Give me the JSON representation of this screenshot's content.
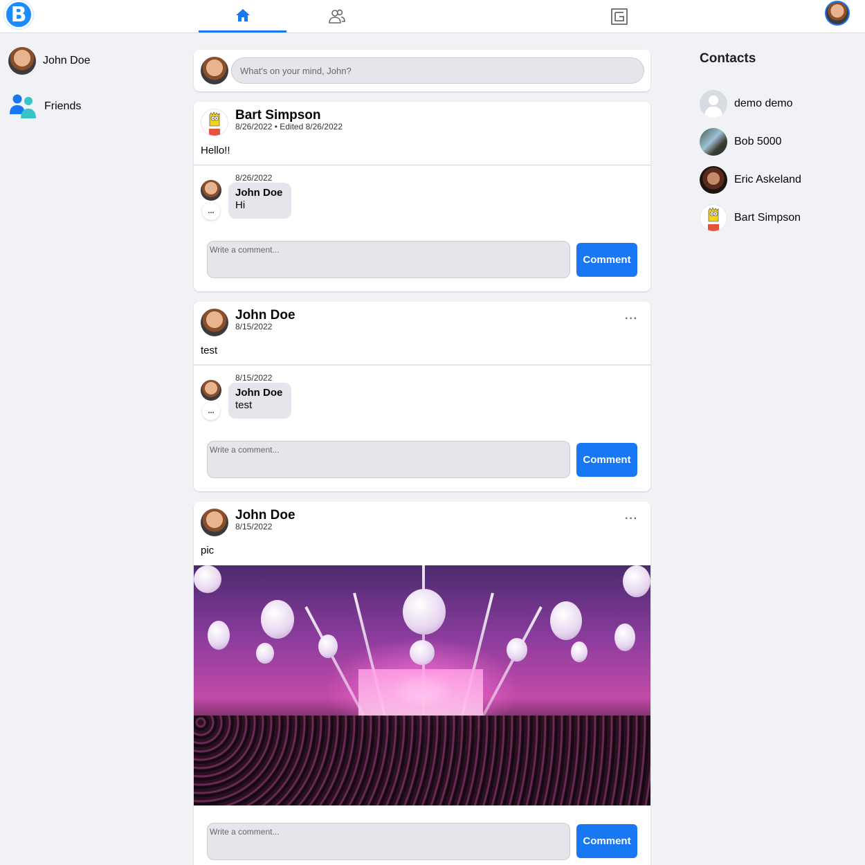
{
  "brand": {
    "logo_letter": "B"
  },
  "nav": {
    "tabs": [
      "home",
      "friends",
      "pages"
    ],
    "active": "home"
  },
  "colors": {
    "accent": "#1877f2",
    "background": "#f0f2f5"
  },
  "left_sidebar": {
    "items": [
      {
        "label": "John Doe",
        "icon": "avatar"
      },
      {
        "label": "Friends",
        "icon": "friends-icon"
      }
    ]
  },
  "composer": {
    "placeholder": "What's on your mind, John?"
  },
  "posts": [
    {
      "author": "Bart Simpson",
      "meta": "8/26/2022 • Edited 8/26/2022",
      "text": "Hello!!",
      "has_more_menu": false,
      "comments": [
        {
          "date": "8/26/2022",
          "author": "John Doe",
          "text": "Hi",
          "more_label": "..."
        }
      ],
      "comment_placeholder": "Write a comment...",
      "comment_button": "Comment"
    },
    {
      "author": "John Doe",
      "meta": "8/15/2022",
      "text": "test",
      "has_more_menu": true,
      "more_label": "···",
      "comments": [
        {
          "date": "8/15/2022",
          "author": "John Doe",
          "text": "test",
          "more_label": "..."
        }
      ],
      "comment_placeholder": "Write a comment...",
      "comment_button": "Comment"
    },
    {
      "author": "John Doe",
      "meta": "8/15/2022",
      "text": "pic",
      "has_more_menu": true,
      "more_label": "···",
      "image": "concert photo",
      "comments": [],
      "comment_placeholder": "Write a comment...",
      "comment_button": "Comment"
    }
  ],
  "contacts": {
    "title": "Contacts",
    "items": [
      {
        "name": "demo demo"
      },
      {
        "name": "Bob 5000"
      },
      {
        "name": "Eric Askeland"
      },
      {
        "name": "Bart Simpson"
      }
    ]
  }
}
